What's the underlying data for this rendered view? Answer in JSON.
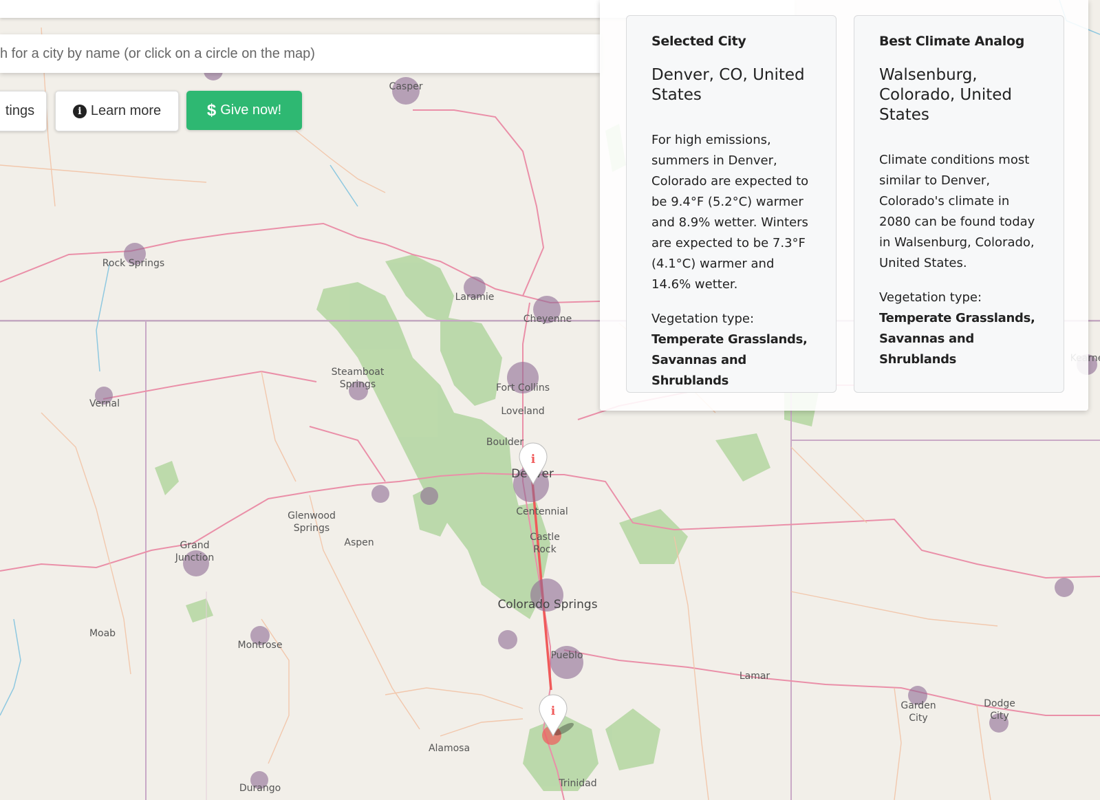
{
  "search": {
    "placeholder_visible": "h for a city by name (or click on a circle on the map)"
  },
  "buttons": {
    "settings": "tings",
    "learn_more": "Learn more",
    "give_now": "Give now!"
  },
  "icons": {
    "info": "info-circle-icon",
    "dollar": "dollar-icon",
    "marker": "map-marker-info-icon"
  },
  "colors": {
    "accent_green": "#2eb872",
    "link_line": "#f05a5a",
    "city_circle": "#8e6a95",
    "forest": "#a6cf95"
  },
  "selected": {
    "title": "Selected City",
    "city": "Denver, CO, United States",
    "description": "For high emissions, summers in Denver, Colorado are expected to be 9.4°F (5.2°C) warmer and 8.9% wetter. Winters are expected to be 7.3°F (4.1°C) warmer and 14.6% wetter.",
    "veg_label": "Vegetation type:",
    "veg_value": "Temperate Grasslands, Savannas and Shrublands"
  },
  "analog": {
    "title": "Best Climate Analog",
    "city": "Walsenburg, Colorado, United States",
    "description": "Climate conditions most similar to Denver, Colorado's climate in 2080 can be found today in Walsenburg, Colorado, United States.",
    "veg_label": "Vegetation type:",
    "veg_value": "Temperate Grasslands, Savannas and Shrublands"
  },
  "map": {
    "labels": {
      "casper": "Casper",
      "rock_springs": "Rock Springs",
      "laramie": "Laramie",
      "cheyenne": "Cheyenne",
      "steamboat1": "Steamboat",
      "steamboat2": "Springs",
      "fort_collins": "Fort Collins",
      "vernal": "Vernal",
      "loveland": "Loveland",
      "boulder": "Boulder",
      "denver": "Denver",
      "centennial": "Centennial",
      "glenwood1": "Glenwood",
      "glenwood2": "Springs",
      "aspen": "Aspen",
      "grand1": "Grand",
      "grand2": "Junction",
      "castle1": "Castle",
      "castle2": "Rock",
      "colorado_springs": "Colorado Springs",
      "moab": "Moab",
      "montrose": "Montrose",
      "pueblo": "Pueblo",
      "lamar": "Lamar",
      "garden1": "Garden",
      "garden2": "City",
      "dodge1": "Dodge",
      "dodge2": "City",
      "alamosa": "Alamosa",
      "durango": "Durango",
      "trinidad": "Trinidad",
      "kearney": "Kearne"
    }
  }
}
